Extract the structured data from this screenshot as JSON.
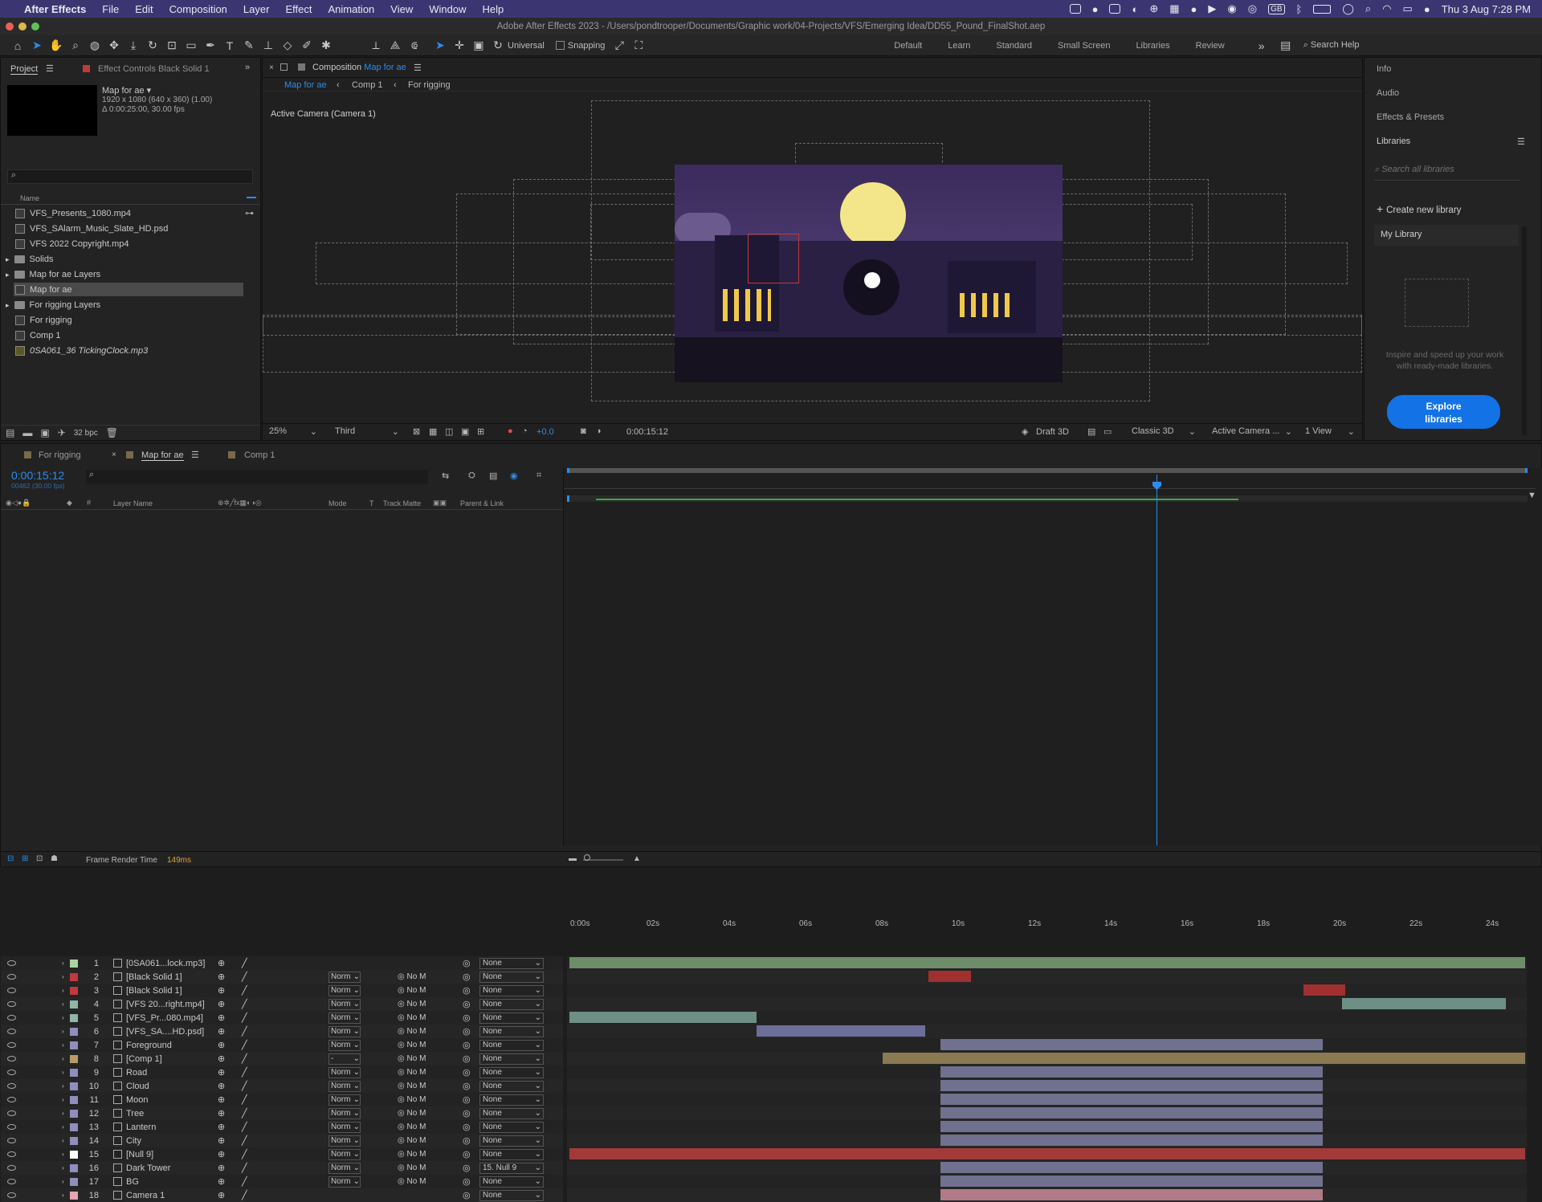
{
  "menubar": {
    "apple": "",
    "app_name": "After Effects",
    "items": [
      "File",
      "Edit",
      "Composition",
      "Layer",
      "Effect",
      "Animation",
      "View",
      "Window",
      "Help"
    ],
    "date_time": "Thu 3 Aug  7:28 PM",
    "input_source": "GB"
  },
  "window_title": "Adobe After Effects 2023 - /Users/pondtrooper/Documents/Graphic work/04-Projects/VFS/Emerging Idea/DD55_Pound_FinalShot.aep",
  "toolbar": {
    "universal_label": "Universal",
    "snapping_label": "Snapping",
    "workspaces": [
      "Default",
      "Learn",
      "Standard",
      "Small Screen",
      "Libraries",
      "Review"
    ],
    "search_help": "Search Help"
  },
  "project_panel": {
    "tab_project": "Project",
    "tab_effect_controls": "Effect Controls Black Solid 1",
    "preview_name": "Map for ae ▾",
    "preview_info1": "1920 x 1080  (640 x 360) (1.00)",
    "preview_info2": "Δ 0:00:25:00, 30.00 fps",
    "col_name": "Name",
    "items": [
      {
        "name": "VFS_Presents_1080.mp4",
        "kind": "file"
      },
      {
        "name": "VFS_SAlarm_Music_Slate_HD.psd",
        "kind": "file"
      },
      {
        "name": "VFS 2022 Copyright.mp4",
        "kind": "file"
      },
      {
        "name": "Solids",
        "kind": "folder"
      },
      {
        "name": "Map for ae Layers",
        "kind": "folder"
      },
      {
        "name": "Map for ae",
        "kind": "comp"
      },
      {
        "name": "For rigging Layers",
        "kind": "folder"
      },
      {
        "name": "For rigging",
        "kind": "comp"
      },
      {
        "name": "Comp 1",
        "kind": "comp"
      },
      {
        "name": "0SA061_36 TickingClock.mp3",
        "kind": "audio"
      }
    ],
    "bpc": "32 bpc"
  },
  "composition_panel": {
    "tab_label": "Composition",
    "tab_comp": "Map for ae",
    "breadcrumbs": [
      "Map for ae",
      "Comp 1",
      "For rigging"
    ],
    "active_camera": "Active Camera (Camera 1)",
    "zoom": "25%",
    "view_res": "Third",
    "exposure": "+0.0",
    "timecode": "0:00:15:12",
    "draft3d": "Draft 3D",
    "renderer": "Classic 3D",
    "camera_view": "Active Camera ...",
    "views": "1 View"
  },
  "right_panel": {
    "sections": [
      "Info",
      "Audio",
      "Effects & Presets",
      "Libraries"
    ],
    "search_placeholder": "Search all libraries",
    "create_new": "Create new library",
    "my_library": "My Library",
    "inspire_text": "Inspire and speed up your work with ready-made libraries.",
    "explore_button": "Explore libraries"
  },
  "timeline": {
    "tabs": [
      "For rigging",
      "Map for ae",
      "Comp 1"
    ],
    "timecode": "0:00:15:12",
    "frame_info": "00462 (30.00 fps)",
    "col_headers": {
      "layer_name": "Layer Name",
      "mode": "Mode",
      "t": "T",
      "track_matte": "Track Matte",
      "parent": "Parent & Link"
    },
    "ruler_ticks": [
      "0:00s",
      "02s",
      "04s",
      "06s",
      "08s",
      "10s",
      "12s",
      "14s",
      "16s",
      "18s",
      "20s",
      "22s",
      "24s"
    ],
    "layers": [
      {
        "num": "1",
        "name": "[0SA061...lock.mp3]",
        "color": "#a8d3a0",
        "mode": "",
        "matte": "",
        "parent": "None"
      },
      {
        "num": "2",
        "name": "[Black Solid 1]",
        "color": "#c03a3a",
        "mode": "Norm",
        "matte": "No M",
        "parent": "None"
      },
      {
        "num": "3",
        "name": "[Black Solid 1]",
        "color": "#c03a3a",
        "mode": "Norm",
        "matte": "No M",
        "parent": "None"
      },
      {
        "num": "4",
        "name": "[VFS 20...right.mp4]",
        "color": "#8fb5a8",
        "mode": "Norm",
        "matte": "No M",
        "parent": "None"
      },
      {
        "num": "5",
        "name": "[VFS_Pr...080.mp4]",
        "color": "#8fb5a8",
        "mode": "Norm",
        "matte": "No M",
        "parent": "None"
      },
      {
        "num": "6",
        "name": "[VFS_SA....HD.psd]",
        "color": "#8e8ec0",
        "mode": "Norm",
        "matte": "No M",
        "parent": "None"
      },
      {
        "num": "7",
        "name": "Foreground",
        "color": "#8e8ec0",
        "mode": "Norm",
        "matte": "No M",
        "parent": "None"
      },
      {
        "num": "8",
        "name": "[Comp 1]",
        "color": "#b89c68",
        "mode": "-",
        "matte": "No M",
        "parent": "None"
      },
      {
        "num": "9",
        "name": "Road",
        "color": "#8e8ec0",
        "mode": "Norm",
        "matte": "No M",
        "parent": "None"
      },
      {
        "num": "10",
        "name": "Cloud",
        "color": "#8e8ec0",
        "mode": "Norm",
        "matte": "No M",
        "parent": "None"
      },
      {
        "num": "11",
        "name": "Moon",
        "color": "#8e8ec0",
        "mode": "Norm",
        "matte": "No M",
        "parent": "None"
      },
      {
        "num": "12",
        "name": "Tree",
        "color": "#8e8ec0",
        "mode": "Norm",
        "matte": "No M",
        "parent": "None"
      },
      {
        "num": "13",
        "name": "Lantern",
        "color": "#8e8ec0",
        "mode": "Norm",
        "matte": "No M",
        "parent": "None"
      },
      {
        "num": "14",
        "name": "City",
        "color": "#8e8ec0",
        "mode": "Norm",
        "matte": "No M",
        "parent": "None"
      },
      {
        "num": "15",
        "name": "[Null 9]",
        "color": "#ffffff",
        "mode": "Norm",
        "matte": "No M",
        "parent": "None"
      },
      {
        "num": "16",
        "name": "Dark Tower",
        "color": "#8e8ec0",
        "mode": "Norm",
        "matte": "No M",
        "parent": "15. Null 9"
      },
      {
        "num": "17",
        "name": "BG",
        "color": "#8e8ec0",
        "mode": "Norm",
        "matte": "No M",
        "parent": "None"
      },
      {
        "num": "18",
        "name": "Camera 1",
        "color": "#e8a3b0",
        "mode": "",
        "matte": "",
        "parent": "None"
      }
    ],
    "footer_label": "Frame Render Time",
    "footer_value": "149ms"
  }
}
